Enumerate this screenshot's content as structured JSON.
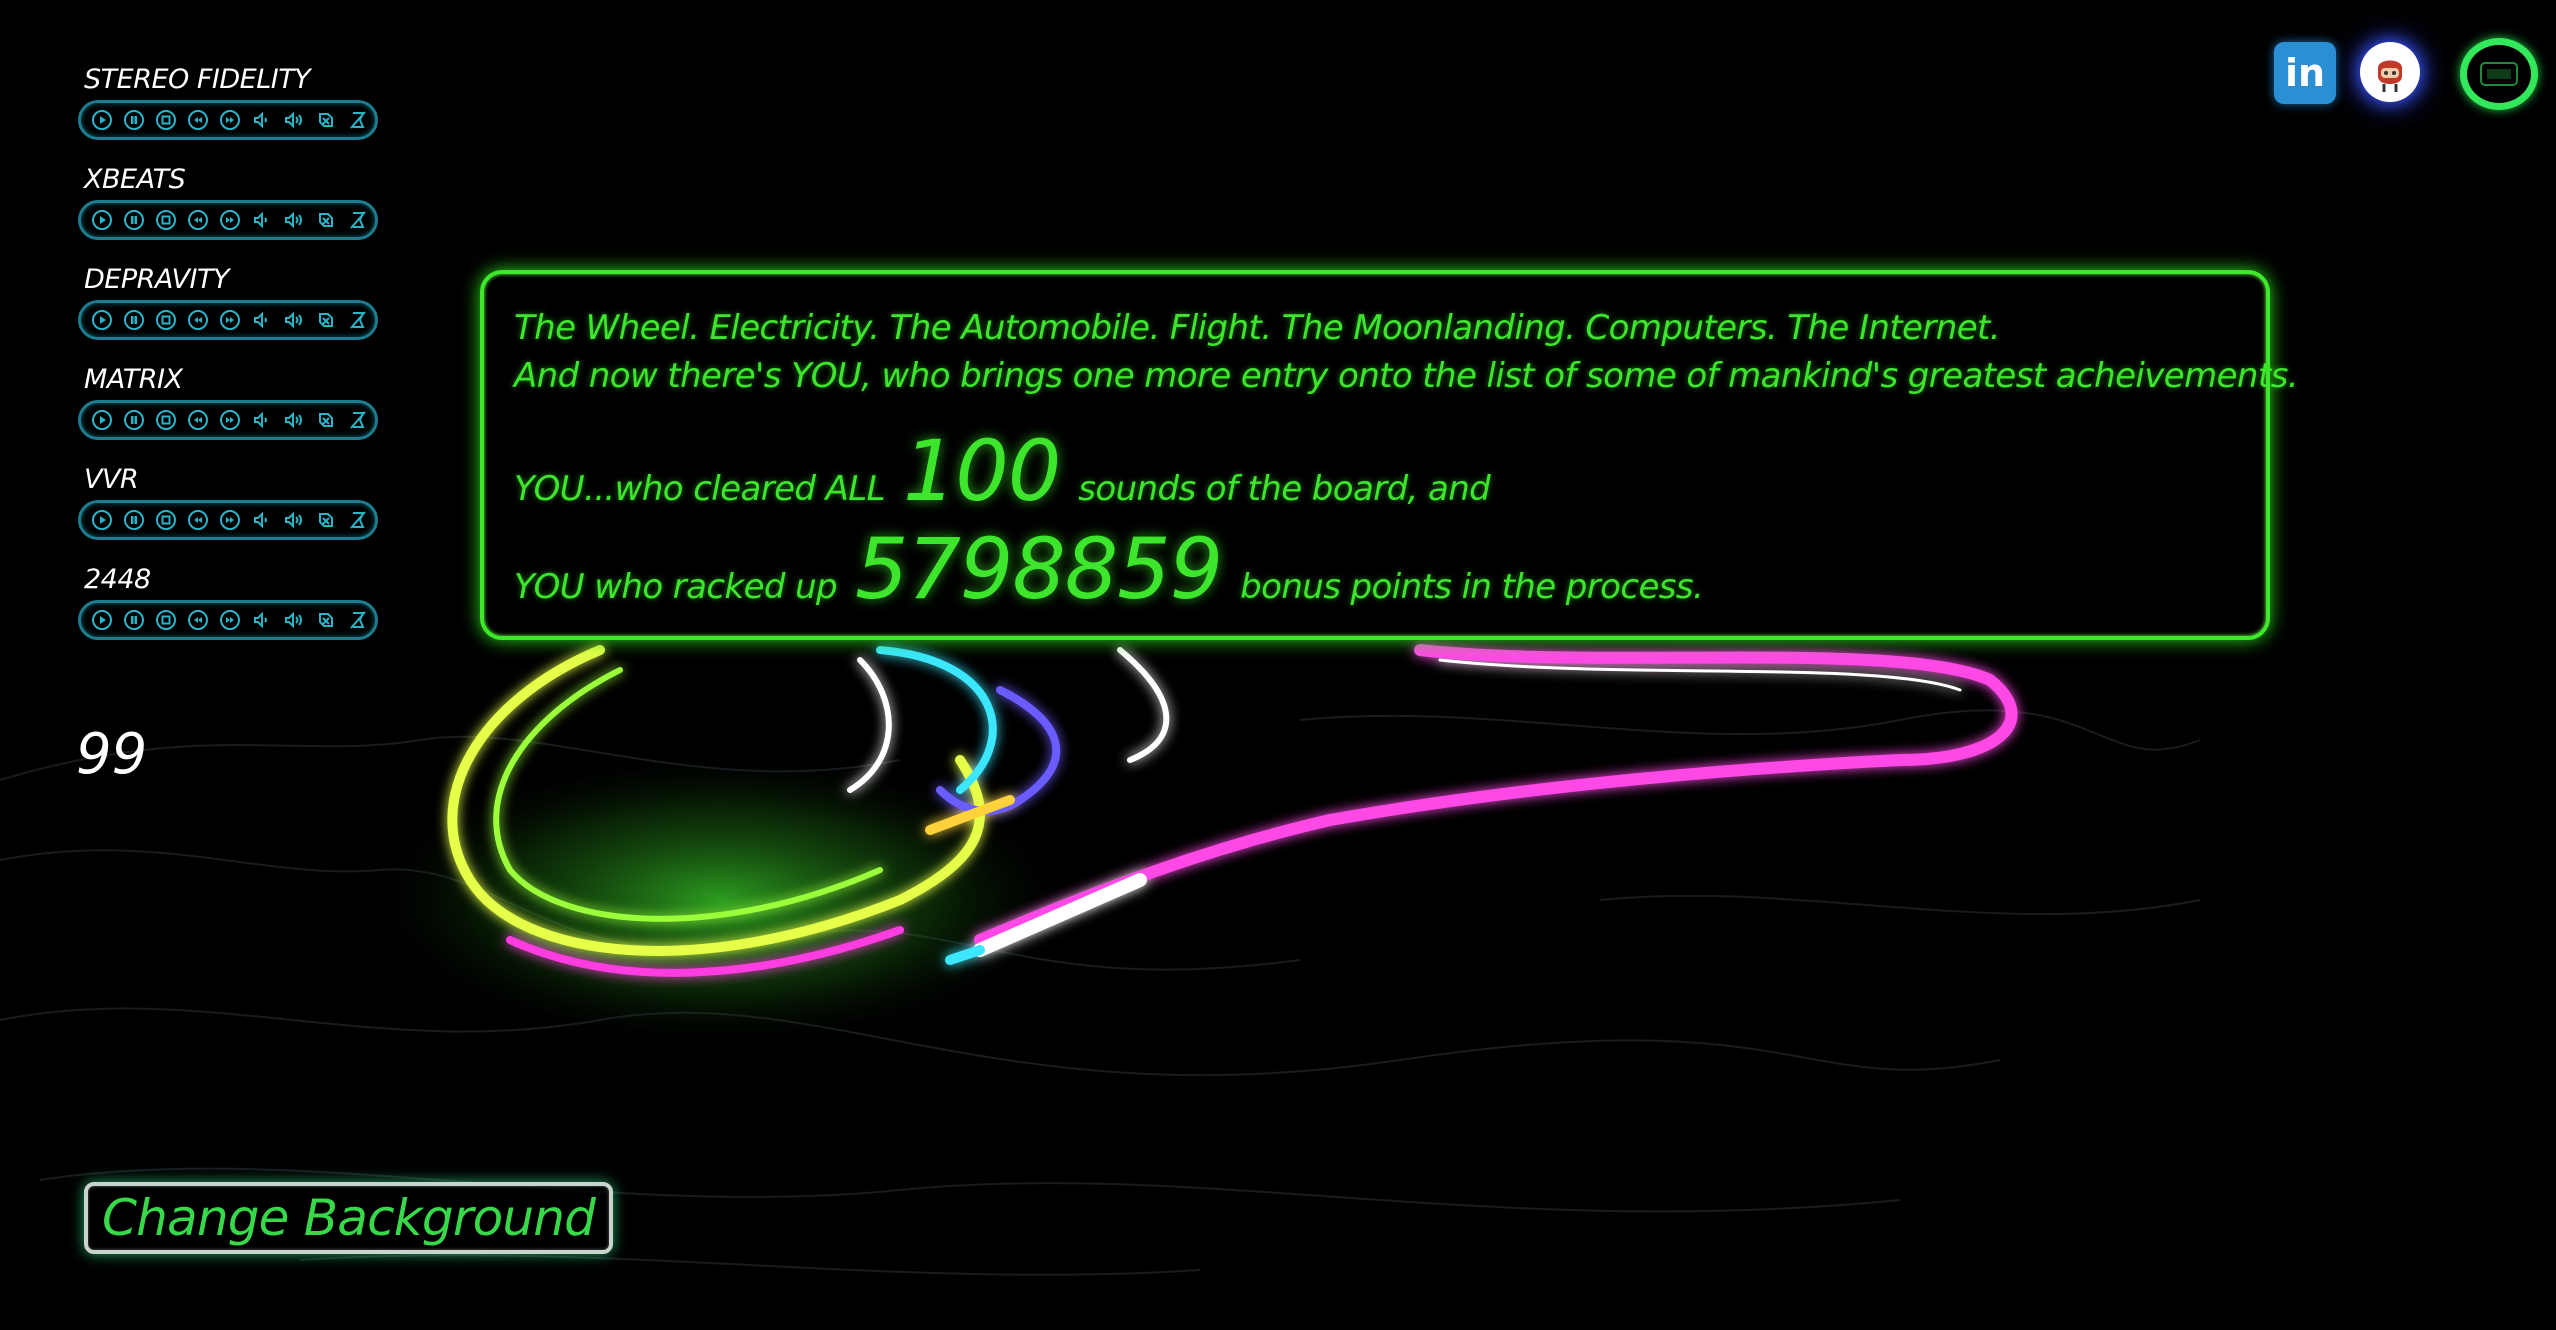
{
  "players": [
    {
      "name": "STEREO FIDELITY"
    },
    {
      "name": "XBEATS"
    },
    {
      "name": "DEPRAVITY"
    },
    {
      "name": "MATRIX"
    },
    {
      "name": "VVR"
    },
    {
      "name": "2448"
    }
  ],
  "player_controls": [
    "play-icon",
    "pause-icon",
    "stop-icon",
    "rewind-icon",
    "fast-forward-icon",
    "volume-down-icon",
    "volume-up-icon",
    "loop-icon",
    "mute-icon"
  ],
  "counter": "99",
  "message": {
    "line1": "The Wheel. Electricity. The Automobile. Flight. The Moonlanding. Computers. The Internet.",
    "line2": "And now there's YOU, who brings one more entry onto the list of some of mankind's greatest acheivements.",
    "cleared_prefix": "YOU...who cleared ALL",
    "cleared_count": "100",
    "cleared_suffix": "sounds of the board, and",
    "points_prefix": "YOU who racked up",
    "points": "5798859",
    "points_suffix": "bonus points in the process."
  },
  "change_background_label": "Change Background",
  "linkedin_label": "in",
  "colors": {
    "accent_green": "#3ee82a",
    "player_border": "#1d7c8e",
    "linkedin_blue": "#2b8fd3"
  }
}
